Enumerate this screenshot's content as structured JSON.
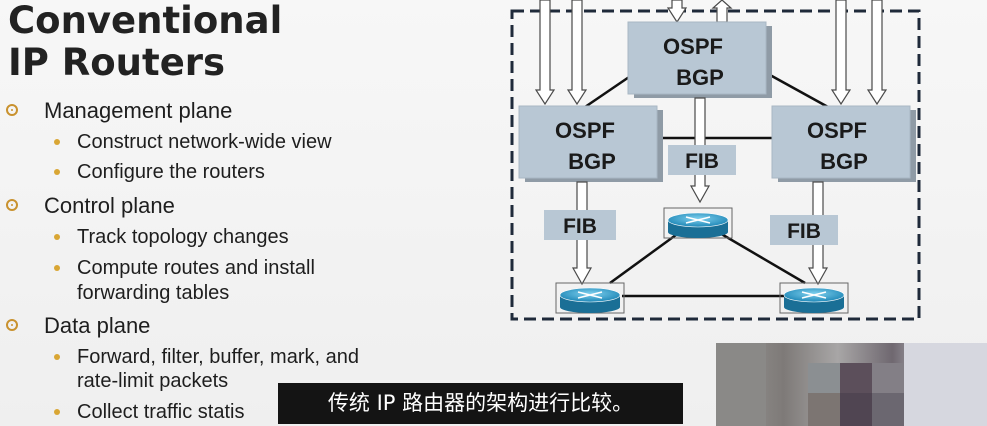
{
  "slide": {
    "title": [
      "Conventional",
      "IP Routers"
    ],
    "bullets": [
      {
        "label": "Management plane",
        "subs": [
          "Construct network-wide view",
          "Configure the routers"
        ]
      },
      {
        "label": "Control plane",
        "subs": [
          "Track topology changes",
          "Compute routes and install",
          "forwarding tables"
        ]
      },
      {
        "label": "Data plane",
        "subs": [
          "Forward, filter, buffer, mark, and",
          "rate-limit packets",
          "Collect traffic statis"
        ]
      }
    ]
  },
  "diagram": {
    "boxes": [
      {
        "line1": "OSPF",
        "line2": "BGP"
      },
      {
        "line1": "OSPF",
        "line2": "BGP"
      },
      {
        "line1": "OSPF",
        "line2": "BGP"
      }
    ],
    "fib_labels": [
      "FIB",
      "FIB",
      "FIB"
    ],
    "routers": [
      "router-icon",
      "router-icon",
      "router-icon"
    ]
  },
  "subtitle": "传统 IP 路由器的架构进行比较。",
  "colors": {
    "bullet_accent": "#c9922f",
    "box_fill": "#b8c7d4",
    "router_fill": "#2a9bc8",
    "subtitle_bg": "#141414"
  }
}
